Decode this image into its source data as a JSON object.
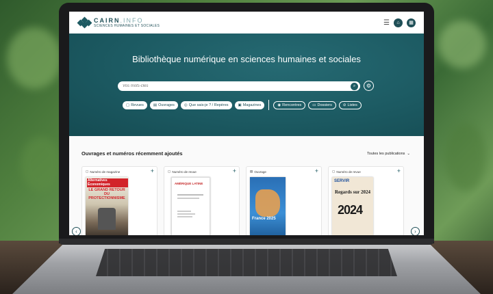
{
  "site": {
    "logo_name": "CAIRN",
    "logo_suffix": ".INFO",
    "logo_sub": "SCIENCES HUMAINES ET SOCIALES"
  },
  "hero": {
    "title": "Bibliothèque numérique en sciences humaines et sociales",
    "search_placeholder": "Vos mots-clés",
    "chips": [
      {
        "label": "Revues"
      },
      {
        "label": "Ouvrages"
      },
      {
        "label": "Que sais-je ? / Repères"
      },
      {
        "label": "Magazines"
      },
      {
        "label": "Rencontres"
      },
      {
        "label": "Dossiers"
      },
      {
        "label": "Listes"
      }
    ]
  },
  "recent": {
    "title": "Ouvrages et numéros récemment ajoutés",
    "filter": "Toutes les publications",
    "cards": [
      {
        "type": "Numéro de magazine",
        "cover_title": "Alternatives Économiques",
        "cover_headline": "LE GRAND RETOUR DU PROTECTIONNISME"
      },
      {
        "type": "Numéro de revue",
        "cover_title": "AMÉRIQUE LATINE"
      },
      {
        "type": "Ouvrage",
        "cover_title": "France 2025"
      },
      {
        "type": "Numéro de revue",
        "cover_title": "SERVIR",
        "cover_headline": "Regards sur 2024",
        "cover_year": "2024"
      }
    ]
  }
}
